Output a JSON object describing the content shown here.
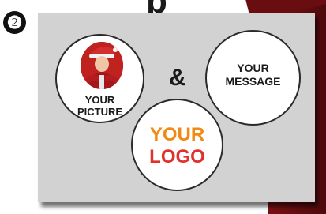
{
  "step": {
    "badge": "❷"
  },
  "top_text_partial": "p",
  "circles": {
    "picture": {
      "line1": "YOUR",
      "line2": "PICTURE",
      "photo_icon": "santa-portrait-icon"
    },
    "message": {
      "line1": "YOUR",
      "line2": "MESSAGE"
    },
    "logo": {
      "line1": "YOUR",
      "line2": "LOGO"
    }
  },
  "connector": "&",
  "colors": {
    "panel": "#d2d2d3",
    "logo_orange": "#f08a12",
    "logo_red": "#e0312c",
    "band_dark_red": "#6a0d10",
    "photo_red": "#b71c1c"
  }
}
